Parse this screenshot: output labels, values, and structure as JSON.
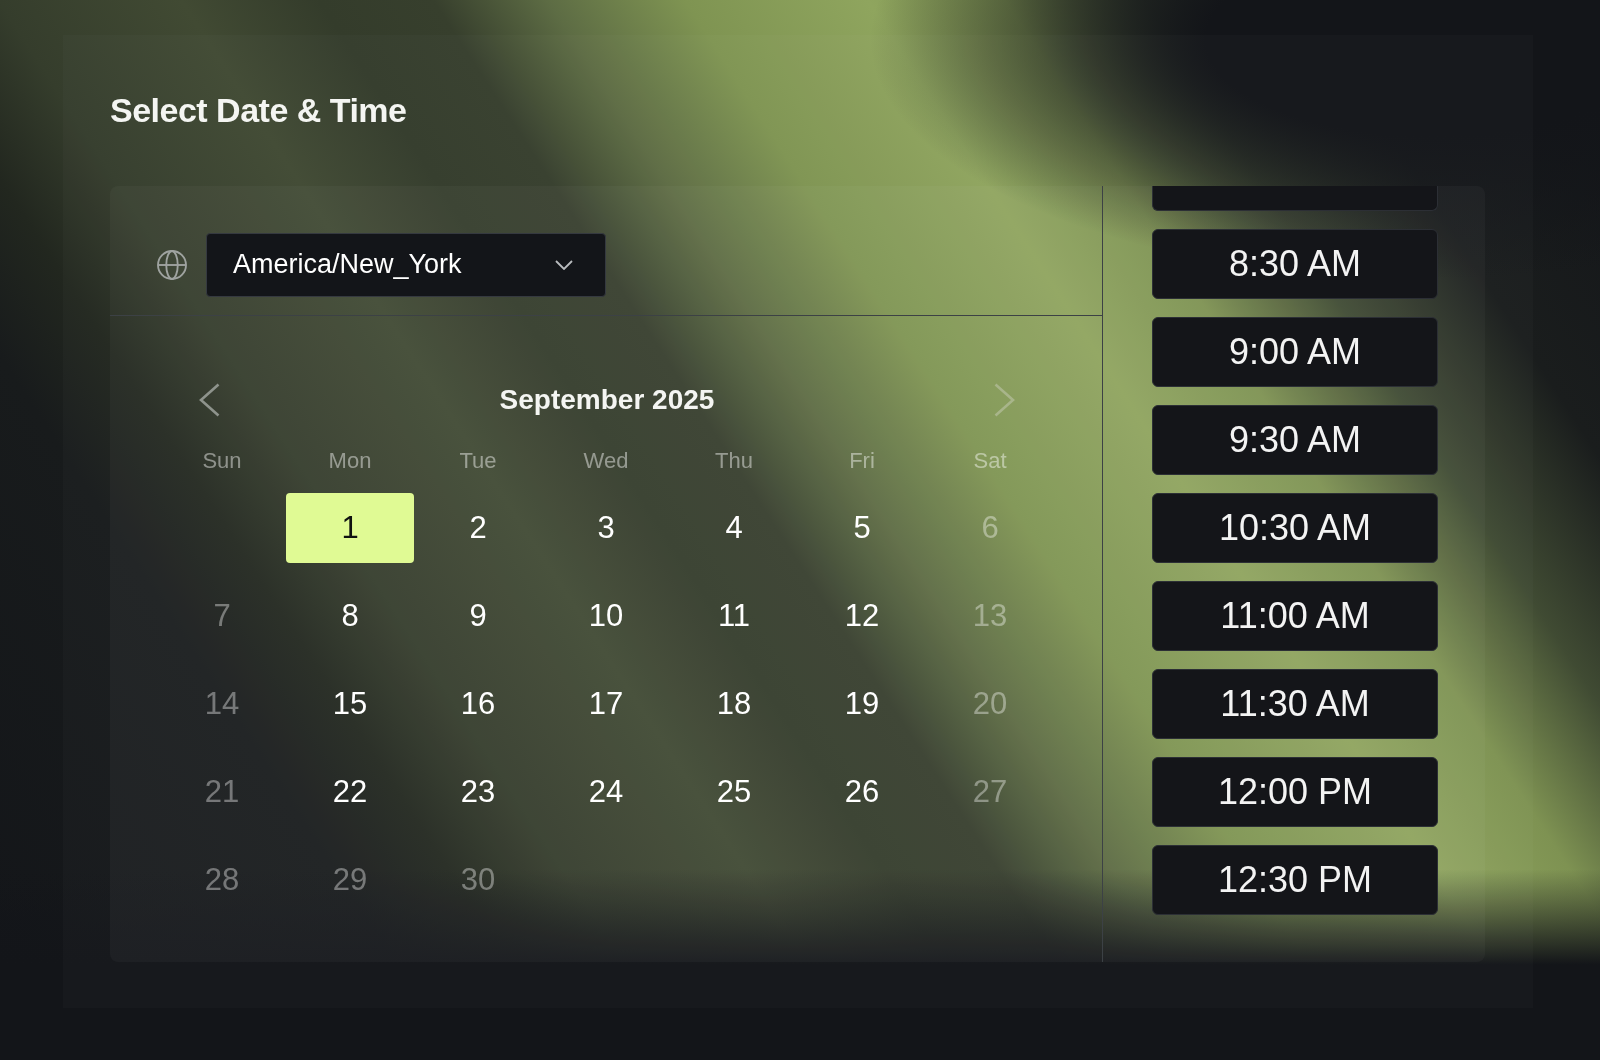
{
  "title": "Select Date & Time",
  "timezone": {
    "value": "America/New_York"
  },
  "calendar": {
    "month": "September 2025",
    "weekdays": [
      "Sun",
      "Mon",
      "Tue",
      "Wed",
      "Thu",
      "Fri",
      "Sat"
    ],
    "weeks": [
      [
        {
          "label": "1",
          "selected": true,
          "disabled": false
        },
        {
          "label": "2",
          "selected": false,
          "disabled": false
        },
        {
          "label": "3",
          "selected": false,
          "disabled": false
        },
        {
          "label": "4",
          "selected": false,
          "disabled": false
        },
        {
          "label": "5",
          "selected": false,
          "disabled": false
        },
        {
          "label": "6",
          "selected": false,
          "disabled": true
        }
      ],
      [
        {
          "label": "7",
          "selected": false,
          "disabled": true
        },
        {
          "label": "8",
          "selected": false,
          "disabled": false
        },
        {
          "label": "9",
          "selected": false,
          "disabled": false
        },
        {
          "label": "10",
          "selected": false,
          "disabled": false
        },
        {
          "label": "11",
          "selected": false,
          "disabled": false
        },
        {
          "label": "12",
          "selected": false,
          "disabled": false
        },
        {
          "label": "13",
          "selected": false,
          "disabled": true
        }
      ],
      [
        {
          "label": "14",
          "selected": false,
          "disabled": true
        },
        {
          "label": "15",
          "selected": false,
          "disabled": false
        },
        {
          "label": "16",
          "selected": false,
          "disabled": false
        },
        {
          "label": "17",
          "selected": false,
          "disabled": false
        },
        {
          "label": "18",
          "selected": false,
          "disabled": false
        },
        {
          "label": "19",
          "selected": false,
          "disabled": false
        },
        {
          "label": "20",
          "selected": false,
          "disabled": true
        }
      ],
      [
        {
          "label": "21",
          "selected": false,
          "disabled": true
        },
        {
          "label": "22",
          "selected": false,
          "disabled": false
        },
        {
          "label": "23",
          "selected": false,
          "disabled": false
        },
        {
          "label": "24",
          "selected": false,
          "disabled": false
        },
        {
          "label": "25",
          "selected": false,
          "disabled": false
        },
        {
          "label": "26",
          "selected": false,
          "disabled": false
        },
        {
          "label": "27",
          "selected": false,
          "disabled": true
        }
      ],
      [
        {
          "label": "28",
          "selected": false,
          "disabled": true
        },
        {
          "label": "29",
          "selected": false,
          "disabled": true
        },
        {
          "label": "30",
          "selected": false,
          "disabled": true
        }
      ]
    ]
  },
  "time_slots": {
    "clipped_above": true,
    "slots": [
      {
        "label": "8:30 AM",
        "selected": false
      },
      {
        "label": "9:00 AM",
        "selected": false
      },
      {
        "label": "9:30 AM",
        "selected": false
      },
      {
        "label": "10:30 AM",
        "selected": false
      },
      {
        "label": "11:00 AM",
        "selected": false
      },
      {
        "label": "11:30 AM",
        "selected": false
      },
      {
        "label": "12:00 PM",
        "selected": false
      },
      {
        "label": "12:30 PM",
        "selected": false
      }
    ]
  }
}
